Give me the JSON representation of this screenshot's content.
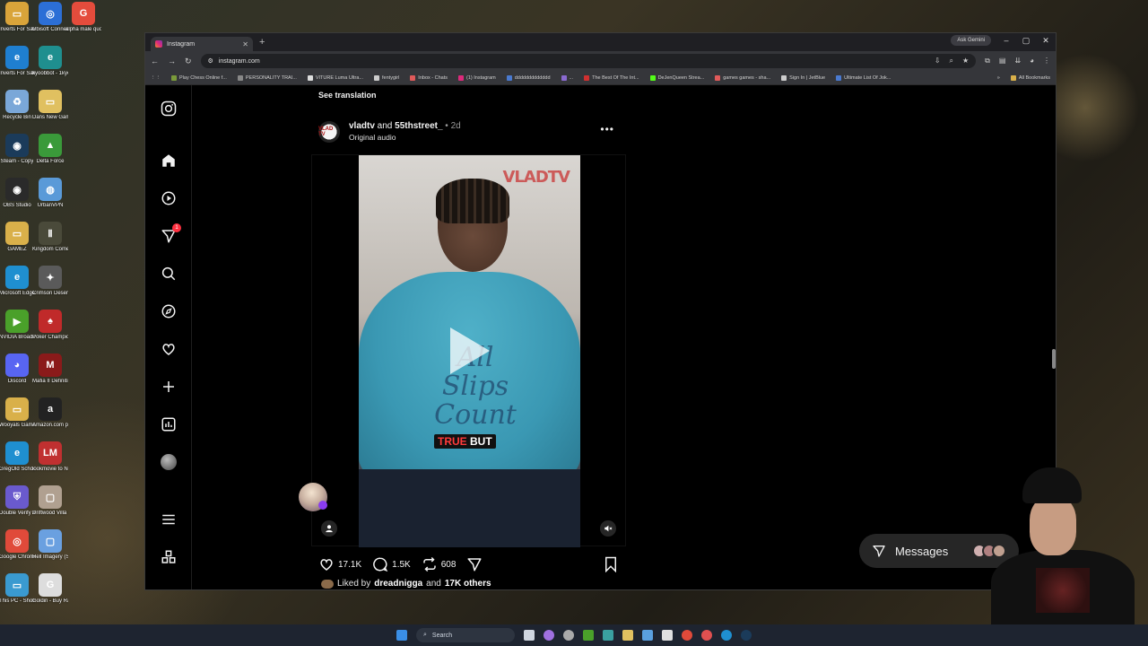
{
  "desktop": {
    "icons": [
      {
        "label": "Inverts For Sale - Spide...",
        "color": "#d9a43a",
        "glyph": "▭"
      },
      {
        "label": "Ubisoft Connect",
        "color": "#2c6fd6",
        "glyph": "◎"
      },
      {
        "label": "alpha male quotes - Go...",
        "color": "#e44c3c",
        "glyph": "G"
      },
      {
        "label": "Inverts For Sale - Spide...",
        "color": "#1f7fd0",
        "glyph": "e"
      },
      {
        "label": "kyoobbot - 1kyoobbo...",
        "color": "#1f8f8f",
        "glyph": "e"
      },
      {
        "label": "Recycle Bin",
        "color": "#7aa7d8",
        "glyph": "♻"
      },
      {
        "label": "Dans New Gaming PICS",
        "color": "#e0c060",
        "glyph": "▭"
      },
      {
        "label": "Steam - Copy",
        "color": "#1b3b5a",
        "glyph": "◉"
      },
      {
        "label": "Delta Force",
        "color": "#3a9a3a",
        "glyph": "▲"
      },
      {
        "label": "OBS Studio",
        "color": "#2a2a2a",
        "glyph": "◉"
      },
      {
        "label": "UrbanVPN",
        "color": "#5a9ad8",
        "glyph": "◍"
      },
      {
        "label": "GAMEZ",
        "color": "#d9b04a",
        "glyph": "▭"
      },
      {
        "label": "Kingdom Come Deliv...",
        "color": "#4a4a3a",
        "glyph": "Ⅱ"
      },
      {
        "label": "Microsoft Edge",
        "color": "#1f8fd0",
        "glyph": "e"
      },
      {
        "label": "Crimson Desert",
        "color": "#5a5a5a",
        "glyph": "✦"
      },
      {
        "label": "NVIDIA Broadcast",
        "color": "#4aa02a",
        "glyph": "▶"
      },
      {
        "label": "Poker Champions...",
        "color": "#c02a2a",
        "glyph": "♠"
      },
      {
        "label": "Discord",
        "color": "#5865f2",
        "glyph": "◕"
      },
      {
        "label": "Mafia II Definiti...",
        "color": "#8a1a1a",
        "glyph": "M"
      },
      {
        "label": "Wooyals Games a...",
        "color": "#d9b04a",
        "glyph": "▭"
      },
      {
        "label": "Amazon.com push ups (...",
        "color": "#222222",
        "glyph": "a"
      },
      {
        "label": "GregOld School Run...",
        "color": "#1f8fd0",
        "glyph": "e"
      },
      {
        "label": "lookmovie to New Movies",
        "color": "#c03030",
        "glyph": "LM"
      },
      {
        "label": "Double Verify Authenticat...",
        "color": "#6a5acd",
        "glyph": "⛨"
      },
      {
        "label": "Driftwood Villa - Luxur...",
        "color": "#b0a090",
        "glyph": "▢"
      },
      {
        "label": "Google Chrome",
        "color": "#e04a3a",
        "glyph": "◎"
      },
      {
        "label": "Hell Imagery (SHAMELESS)",
        "color": "#6aa0e0",
        "glyph": "▢"
      },
      {
        "label": "This PC - Shortcut",
        "color": "#3a9ad0",
        "glyph": "▭"
      },
      {
        "label": "Goldin - Buy Rare Collect...",
        "color": "#dddddd",
        "glyph": "G"
      }
    ]
  },
  "browser": {
    "tab_title": "Instagram",
    "url": "instagram.com",
    "ask_gemini": "Ask Gemini",
    "bookmarks": [
      {
        "label": "Play Chess Online f...",
        "color": "#7a9a3a"
      },
      {
        "label": "PERSONALITY TRAI...",
        "color": "#888888"
      },
      {
        "label": "VITURE Luma Ultra...",
        "color": "#dddddd"
      },
      {
        "label": "fentygirl",
        "color": "#cccccc"
      },
      {
        "label": "Inbox - Chats",
        "color": "#e05a5a"
      },
      {
        "label": "(1) Instagram",
        "color": "#dd2a7b"
      },
      {
        "label": "ddddddddddddd",
        "color": "#4a7ad0"
      },
      {
        "label": "...",
        "color": "#8a6ad0"
      },
      {
        "label": "The Best Of The Int...",
        "color": "#d03030"
      },
      {
        "label": "DeJenQueen Strea...",
        "color": "#53fc18"
      },
      {
        "label": "games games - sha...",
        "color": "#e05a5a"
      },
      {
        "label": "Sign In | JetBlue",
        "color": "#cccccc"
      },
      {
        "label": "Ultimate List Of Jok...",
        "color": "#4a7ad0"
      }
    ],
    "all_bookmarks": "All Bookmarks"
  },
  "instagram": {
    "notification_count": "1",
    "see_translation": "See translation",
    "post": {
      "avatar_text": "VLAD TV",
      "user1": "vladtv",
      "and": " and ",
      "user2": "55thstreet_",
      "time": " • 2d",
      "audio": "Original audio",
      "watermark_a": "VLAD",
      "watermark_b": "TV",
      "shirt_text": "All Slips Count",
      "caption_red": "TRUE",
      "caption_white": " BUT",
      "likes": "17.1K",
      "comments": "1.5K",
      "reposts": "608",
      "liked_by_prefix": "Liked by ",
      "liked_by_user": "dreadnigga",
      "liked_by_mid": " and ",
      "liked_by_others": "17K others"
    },
    "messages_label": "Messages"
  },
  "taskbar": {
    "search_label": "Search"
  }
}
